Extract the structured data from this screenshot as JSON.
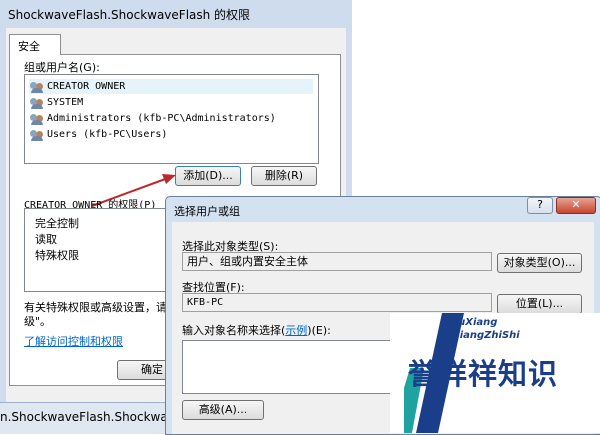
{
  "main_window": {
    "title": "ShockwaveFlash.ShockwaveFlash 的权限",
    "tab": "安全",
    "group_label": "组或用户名(G):",
    "users": [
      "CREATOR OWNER",
      "SYSTEM",
      "Administrators (kfb-PC\\Administrators)",
      "Users (kfb-PC\\Users)"
    ],
    "add_button": "添加(D)...",
    "remove_button": "删除(R)",
    "perm_label": "CREATOR OWNER 的权限(P)",
    "permissions": [
      "完全控制",
      "读取",
      "特殊权限"
    ],
    "advanced_text_1": "有关特殊权限或高级设置，请",
    "advanced_text_2": "级\"。",
    "link": "了解访问控制和权限",
    "ok_button": "确定",
    "taskbar_text": "n.ShockwaveFlash.ShockwaveFlash"
  },
  "dialog": {
    "title": "选择用户或组",
    "help_btn": "?",
    "close_btn": "✕",
    "obj_type_label": "选择此对象类型(S):",
    "obj_type_value": "用户、组或内置安全主体",
    "obj_type_button": "对象类型(O)...",
    "location_label": "查找位置(F):",
    "location_value": "KFB-PC",
    "location_button": "位置(L)...",
    "enter_label_pre": "输入对象名称来选择(",
    "enter_label_link": "示例",
    "enter_label_post": ")(E):",
    "advanced_button": "高级(A)..."
  },
  "watermark": {
    "pinyin_1": "YuXiang",
    "pinyin_2": "XiangZhiShi",
    "text": "誉祥祥知识"
  },
  "colors": {
    "accent": "#0066cc",
    "arrow": "#c0272d",
    "logo_blue": "#1b3e8a",
    "logo_teal": "#1fa3a0"
  }
}
